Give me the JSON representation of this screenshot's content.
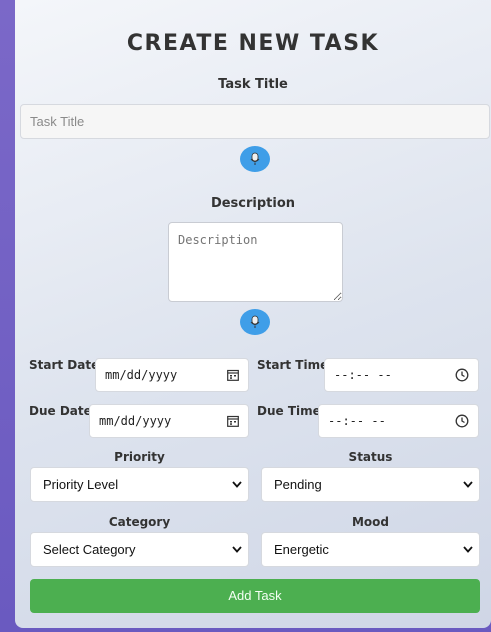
{
  "form": {
    "heading": "CREATE NEW TASK",
    "task_title_label": "Task Title",
    "task_title_placeholder": "Task Title",
    "description_label": "Description",
    "description_placeholder": "Description",
    "start_date_label": "Start Date",
    "start_date_value": "mm/dd/yyyy",
    "start_time_label": "Start Time",
    "start_time_value": "--:-- --",
    "due_date_label": "Due Date",
    "due_date_value": "mm/dd/yyyy",
    "due_time_label": "Due Time",
    "due_time_value": "--:-- --",
    "priority_label": "Priority",
    "priority_value": "Priority Level",
    "status_label": "Status",
    "status_value": "Pending",
    "category_label": "Category",
    "category_value": "Select Category",
    "mood_label": "Mood",
    "mood_value": "Energetic",
    "submit_label": "Add Task"
  },
  "icons": {
    "voice": "microphone-icon",
    "calendar": "calendar-icon",
    "clock": "clock-icon",
    "dropdown": "chevron-down-icon"
  },
  "colors": {
    "accent_button": "#4caf50",
    "voice_button": "#3f9ee8",
    "background": "#6a5ac0"
  }
}
